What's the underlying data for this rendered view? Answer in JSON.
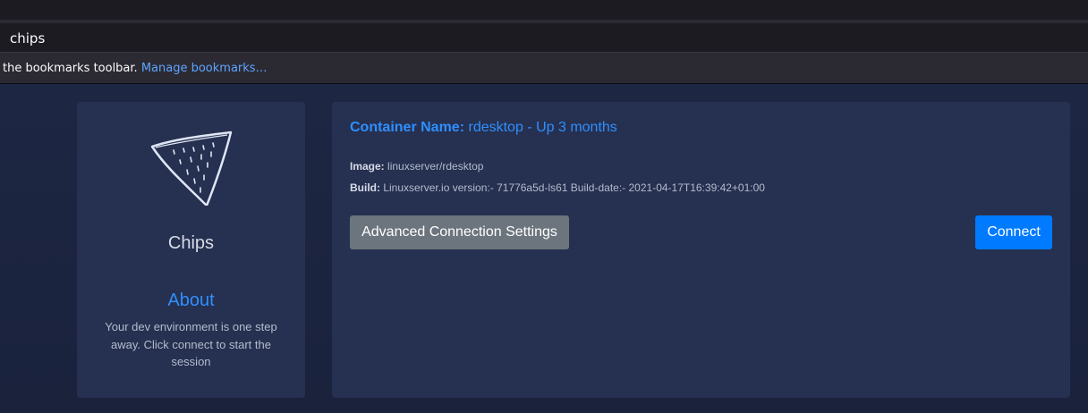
{
  "browser": {
    "url_text": "chips",
    "bookmarks_text": "the bookmarks toolbar.",
    "bookmarks_link": "Manage bookmarks…"
  },
  "sidebar": {
    "app_name": "Chips",
    "about_title": "About",
    "about_text": "Your dev environment is one step away. Click connect to start the session",
    "logo_icon": "chip-icon"
  },
  "main": {
    "container_label": "Container Name:",
    "container_value": "rdesktop - Up 3 months",
    "image_label": "Image:",
    "image_value": "linuxserver/rdesktop",
    "build_label": "Build:",
    "build_value": "Linuxserver.io version:- 71776a5d-ls61 Build-date:- 2021-04-17T16:39:42+01:00",
    "advanced_button": "Advanced Connection Settings",
    "connect_button": "Connect"
  },
  "colors": {
    "accent": "#007bff",
    "link": "#2f8fff",
    "secondary_button": "#6c757d",
    "card_bg": "#263050",
    "page_bg": "#1c2540"
  }
}
